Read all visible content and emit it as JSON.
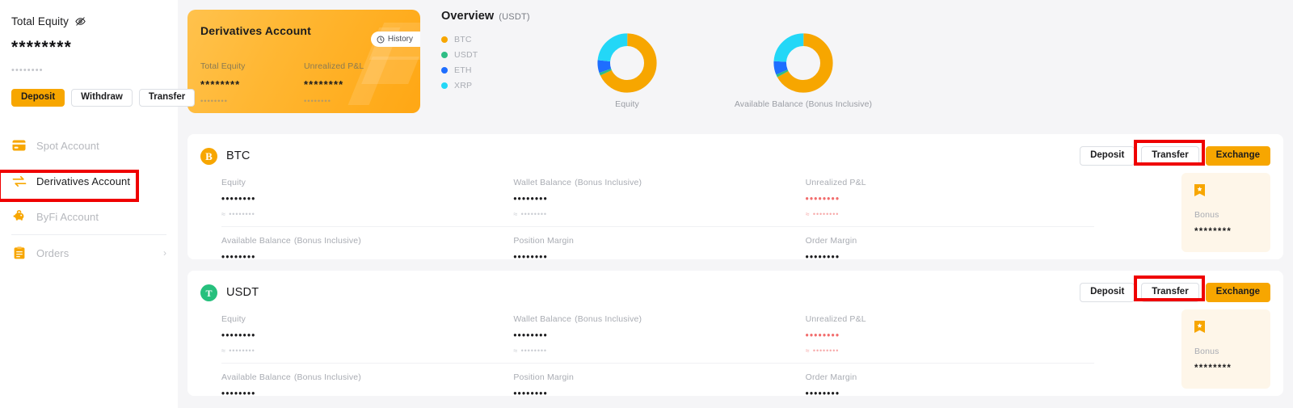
{
  "sidebar": {
    "equity": {
      "title": "Total Equity",
      "hide_icon": "eye-off-icon",
      "value": "********",
      "sub_value": "••••••••"
    },
    "actions": [
      {
        "label": "Deposit",
        "style": "primary"
      },
      {
        "label": "Withdraw",
        "style": "outline"
      },
      {
        "label": "Transfer",
        "style": "outline"
      }
    ],
    "nav": [
      {
        "label": "Spot Account",
        "icon": "wallet-card-icon",
        "active": false,
        "chevron": ""
      },
      {
        "label": "Derivatives Account",
        "icon": "exchange-arrows-icon",
        "active": true,
        "chevron": ""
      },
      {
        "label": "ByFi Account",
        "icon": "piggy-bank-icon",
        "active": false,
        "chevron": ""
      },
      {
        "label": "Orders",
        "icon": "clipboard-icon",
        "active": false,
        "chevron": "›"
      }
    ]
  },
  "account_card": {
    "title": "Derivatives Account",
    "history_label": "History",
    "history_icon": "clock-icon",
    "metrics": [
      {
        "label": "Total Equity",
        "value": "********",
        "sub": "••••••••"
      },
      {
        "label": "Unrealized P&L",
        "value": "********",
        "sub": "••••••••"
      }
    ]
  },
  "overview": {
    "title": "Overview",
    "unit": "(USDT)",
    "legend": [
      {
        "label": "BTC",
        "color": "#f7a600"
      },
      {
        "label": "USDT",
        "color": "#2ebd85"
      },
      {
        "label": "ETH",
        "color": "#1e6eff"
      },
      {
        "label": "XRP",
        "color": "#23d7f7"
      }
    ]
  },
  "chart_data": [
    {
      "type": "pie",
      "title": "Equity",
      "categories": [
        "BTC",
        "USDT",
        "ETH",
        "XRP"
      ],
      "values": [
        68,
        1.5,
        7,
        23.5
      ],
      "colors": [
        "#f7a600",
        "#2ebd85",
        "#1e6eff",
        "#23d7f7"
      ],
      "unit": "USDT",
      "legend": "left",
      "donut": true,
      "inner_radius_ratio": 0.55
    },
    {
      "type": "pie",
      "title": "Available Balance (Bonus Inclusive)",
      "categories": [
        "BTC",
        "USDT",
        "ETH",
        "XRP"
      ],
      "values": [
        67,
        1.5,
        7.5,
        24
      ],
      "colors": [
        "#f7a600",
        "#2ebd85",
        "#1e6eff",
        "#23d7f7"
      ],
      "unit": "USDT",
      "legend": "left",
      "donut": true,
      "inner_radius_ratio": 0.55
    }
  ],
  "assets": [
    {
      "symbol": "BTC",
      "icon": "bitcoin-icon",
      "icon_color": "#f7a600",
      "icon_glyph": "₿",
      "actions": [
        {
          "label": "Deposit",
          "style": "outline"
        },
        {
          "label": "Transfer",
          "style": "outline",
          "highlighted": true
        },
        {
          "label": "Exchange",
          "style": "amber"
        }
      ],
      "metrics_row1": [
        {
          "label": "Equity",
          "paren": "",
          "value": "••••••••",
          "sub": "≈ ••••••••",
          "negative": false
        },
        {
          "label": "Wallet Balance",
          "paren": "(Bonus Inclusive)",
          "value": "••••••••",
          "sub": "≈ ••••••••",
          "negative": false
        },
        {
          "label": "Unrealized P&L",
          "paren": "",
          "value": "••••••••",
          "sub": "≈ ••••••••",
          "negative": true
        }
      ],
      "metrics_row2": [
        {
          "label": "Available Balance",
          "paren": "(Bonus Inclusive)",
          "value": "••••••••",
          "sub": "",
          "negative": false
        },
        {
          "label": "Position Margin",
          "paren": "",
          "value": "••••••••",
          "sub": "",
          "negative": false
        },
        {
          "label": "Order Margin",
          "paren": "",
          "value": "••••••••",
          "sub": "",
          "negative": false
        }
      ],
      "bonus": {
        "label": "Bonus",
        "value": "********",
        "icon": "bonus-ticket-icon"
      }
    },
    {
      "symbol": "USDT",
      "icon": "tether-icon",
      "icon_color": "#26c07d",
      "icon_glyph": "₮",
      "actions": [
        {
          "label": "Deposit",
          "style": "outline"
        },
        {
          "label": "Transfer",
          "style": "outline",
          "highlighted": true
        },
        {
          "label": "Exchange",
          "style": "amber"
        }
      ],
      "metrics_row1": [
        {
          "label": "Equity",
          "paren": "",
          "value": "••••••••",
          "sub": "≈ ••••••••",
          "negative": false
        },
        {
          "label": "Wallet Balance",
          "paren": "(Bonus Inclusive)",
          "value": "••••••••",
          "sub": "≈ ••••••••",
          "negative": false
        },
        {
          "label": "Unrealized P&L",
          "paren": "",
          "value": "••••••••",
          "sub": "≈ ••••••••",
          "negative": true
        }
      ],
      "metrics_row2": [
        {
          "label": "Available Balance",
          "paren": "(Bonus Inclusive)",
          "value": "••••••••",
          "sub": "",
          "negative": false
        },
        {
          "label": "Position Margin",
          "paren": "",
          "value": "••••••••",
          "sub": "",
          "negative": false
        },
        {
          "label": "Order Margin",
          "paren": "",
          "value": "••••••••",
          "sub": "",
          "negative": false
        }
      ],
      "bonus": {
        "label": "Bonus",
        "value": "********",
        "icon": "bonus-ticket-icon"
      }
    }
  ],
  "theme": {
    "accent": "#f7a600",
    "background": "#f5f5f7",
    "surface": "#ffffff",
    "text": "#1c1c1e",
    "muted": "#a9acb3",
    "negative": "#f26d6d",
    "annotation": "#ef0000",
    "bonus_bg": "#fef6e9"
  }
}
